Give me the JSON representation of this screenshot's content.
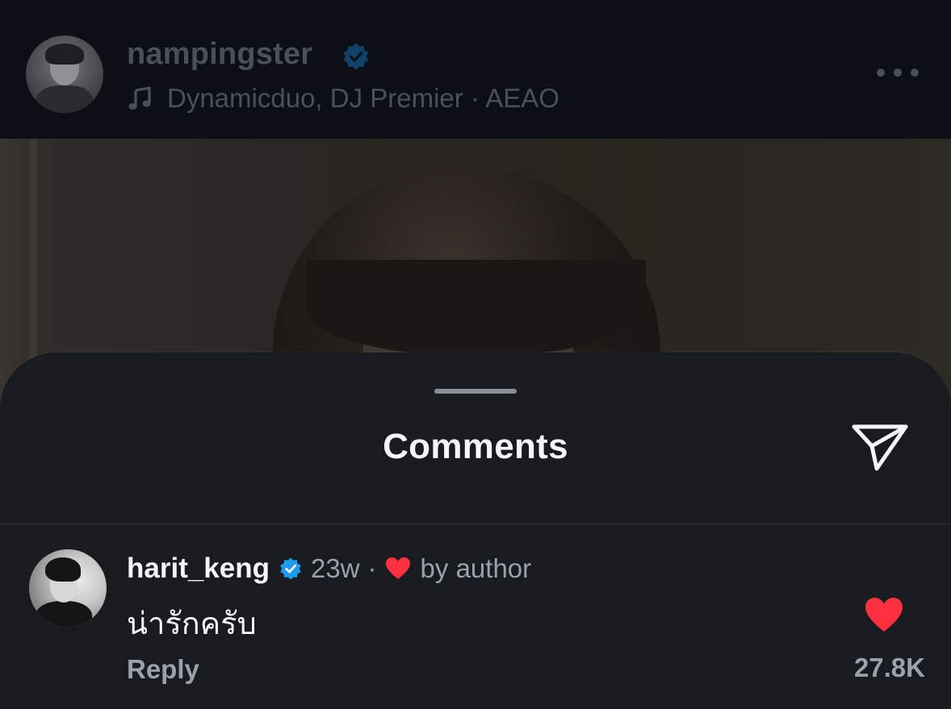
{
  "post": {
    "username": "nampingster",
    "verified": true,
    "music": "Dynamicduo, DJ Premier · AEAO",
    "avatar_icon": "profile-photo",
    "more_icon": "more-horizontal-icon"
  },
  "comments_sheet": {
    "title": "Comments",
    "share_icon": "paper-plane-share-icon"
  },
  "comments": [
    {
      "username": "harit_keng",
      "verified": true,
      "time": "23w",
      "separator": "·",
      "liked_by_author_label": "by author",
      "text": "น่ารักครับ",
      "reply_label": "Reply",
      "liked": true,
      "like_count": "27.8K"
    }
  ],
  "colors": {
    "verified_blue": "#1d9bf0",
    "like_red": "#ff3040",
    "sheet_background": "#181b20",
    "muted_text": "#9ba1aa"
  }
}
